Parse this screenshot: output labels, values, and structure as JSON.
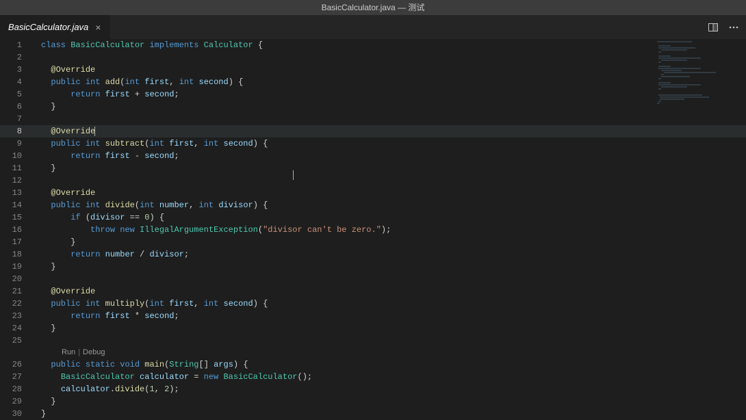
{
  "title": "BasicCalculator.java — 测试",
  "tab": {
    "label": "BasicCalculator.java",
    "close_tooltip": "Close"
  },
  "actions": {
    "split_tooltip": "Split Editor Right",
    "more_tooltip": "More Actions..."
  },
  "codelens": {
    "run": "Run",
    "debug": "Debug"
  },
  "code": {
    "lines": [
      [
        [
          "kw",
          "class "
        ],
        [
          "type",
          "BasicCalculator "
        ],
        [
          "kw",
          "implements "
        ],
        [
          "type",
          "Calculator "
        ],
        [
          "pun",
          "{"
        ]
      ],
      [],
      [
        [
          "pun",
          "  "
        ],
        [
          "ann",
          "@Override"
        ]
      ],
      [
        [
          "pun",
          "  "
        ],
        [
          "kw",
          "public "
        ],
        [
          "kw",
          "int "
        ],
        [
          "fn",
          "add"
        ],
        [
          "pun",
          "("
        ],
        [
          "kw",
          "int "
        ],
        [
          "var",
          "first"
        ],
        [
          "pun",
          ", "
        ],
        [
          "kw",
          "int "
        ],
        [
          "var",
          "second"
        ],
        [
          "pun",
          ") {"
        ]
      ],
      [
        [
          "pun",
          "      "
        ],
        [
          "kw",
          "return "
        ],
        [
          "var",
          "first"
        ],
        [
          "pun",
          " + "
        ],
        [
          "var",
          "second"
        ],
        [
          "pun",
          ";"
        ]
      ],
      [
        [
          "pun",
          "  }"
        ]
      ],
      [],
      [
        [
          "pun",
          "  "
        ],
        [
          "ann",
          "@Override"
        ]
      ],
      [
        [
          "pun",
          "  "
        ],
        [
          "kw",
          "public "
        ],
        [
          "kw",
          "int "
        ],
        [
          "fn",
          "subtract"
        ],
        [
          "pun",
          "("
        ],
        [
          "kw",
          "int "
        ],
        [
          "var",
          "first"
        ],
        [
          "pun",
          ", "
        ],
        [
          "kw",
          "int "
        ],
        [
          "var",
          "second"
        ],
        [
          "pun",
          ") {"
        ]
      ],
      [
        [
          "pun",
          "      "
        ],
        [
          "kw",
          "return "
        ],
        [
          "var",
          "first"
        ],
        [
          "pun",
          " - "
        ],
        [
          "var",
          "second"
        ],
        [
          "pun",
          ";"
        ]
      ],
      [
        [
          "pun",
          "  }"
        ]
      ],
      [],
      [
        [
          "pun",
          "  "
        ],
        [
          "ann",
          "@Override"
        ]
      ],
      [
        [
          "pun",
          "  "
        ],
        [
          "kw",
          "public "
        ],
        [
          "kw",
          "int "
        ],
        [
          "fn",
          "divide"
        ],
        [
          "pun",
          "("
        ],
        [
          "kw",
          "int "
        ],
        [
          "var",
          "number"
        ],
        [
          "pun",
          ", "
        ],
        [
          "kw",
          "int "
        ],
        [
          "var",
          "divisor"
        ],
        [
          "pun",
          ") {"
        ]
      ],
      [
        [
          "pun",
          "      "
        ],
        [
          "kw",
          "if "
        ],
        [
          "pun",
          "("
        ],
        [
          "var",
          "divisor"
        ],
        [
          "pun",
          " == "
        ],
        [
          "num",
          "0"
        ],
        [
          "pun",
          ") {"
        ]
      ],
      [
        [
          "pun",
          "          "
        ],
        [
          "kw",
          "throw "
        ],
        [
          "kw",
          "new "
        ],
        [
          "type",
          "IllegalArgumentException"
        ],
        [
          "pun",
          "("
        ],
        [
          "str",
          "\"divisor can't be zero.\""
        ],
        [
          "pun",
          ");"
        ]
      ],
      [
        [
          "pun",
          "      }"
        ]
      ],
      [
        [
          "pun",
          "      "
        ],
        [
          "kw",
          "return "
        ],
        [
          "var",
          "number"
        ],
        [
          "pun",
          " / "
        ],
        [
          "var",
          "divisor"
        ],
        [
          "pun",
          ";"
        ]
      ],
      [
        [
          "pun",
          "  }"
        ]
      ],
      [],
      [
        [
          "pun",
          "  "
        ],
        [
          "ann",
          "@Override"
        ]
      ],
      [
        [
          "pun",
          "  "
        ],
        [
          "kw",
          "public "
        ],
        [
          "kw",
          "int "
        ],
        [
          "fn",
          "multiply"
        ],
        [
          "pun",
          "("
        ],
        [
          "kw",
          "int "
        ],
        [
          "var",
          "first"
        ],
        [
          "pun",
          ", "
        ],
        [
          "kw",
          "int "
        ],
        [
          "var",
          "second"
        ],
        [
          "pun",
          ") {"
        ]
      ],
      [
        [
          "pun",
          "      "
        ],
        [
          "kw",
          "return "
        ],
        [
          "var",
          "first"
        ],
        [
          "pun",
          " * "
        ],
        [
          "var",
          "second"
        ],
        [
          "pun",
          ";"
        ]
      ],
      [
        [
          "pun",
          "  }"
        ]
      ],
      [],
      [
        [
          "pun",
          "  "
        ],
        [
          "kw",
          "public "
        ],
        [
          "kw",
          "static "
        ],
        [
          "kw",
          "void "
        ],
        [
          "fn",
          "main"
        ],
        [
          "pun",
          "("
        ],
        [
          "type",
          "String"
        ],
        [
          "pun",
          "[] "
        ],
        [
          "var",
          "args"
        ],
        [
          "pun",
          ") {"
        ]
      ],
      [
        [
          "pun",
          "    "
        ],
        [
          "type",
          "BasicCalculator "
        ],
        [
          "var",
          "calculator"
        ],
        [
          "pun",
          " = "
        ],
        [
          "kw",
          "new "
        ],
        [
          "type",
          "BasicCalculator"
        ],
        [
          "pun",
          "();"
        ]
      ],
      [
        [
          "pun",
          "    "
        ],
        [
          "var",
          "calculator"
        ],
        [
          "pun",
          "."
        ],
        [
          "fn",
          "divide"
        ],
        [
          "pun",
          "("
        ],
        [
          "num",
          "1"
        ],
        [
          "pun",
          ", "
        ],
        [
          "num",
          "2"
        ],
        [
          "pun",
          ");"
        ]
      ],
      [
        [
          "pun",
          "  }"
        ]
      ],
      [
        [
          "pun",
          "}"
        ]
      ]
    ],
    "codelens_before_line": 26,
    "current_line": 8
  }
}
